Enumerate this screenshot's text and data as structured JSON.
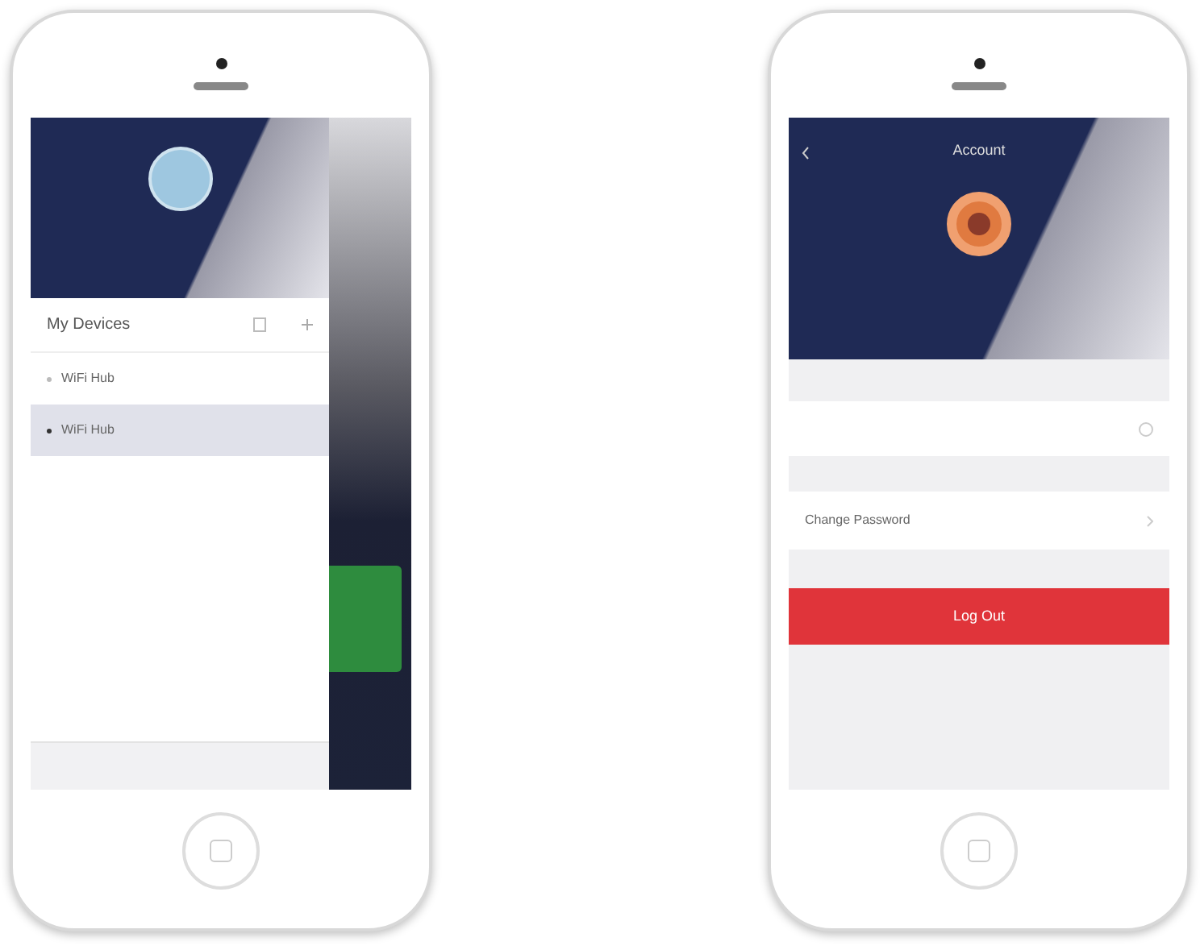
{
  "left_phone": {
    "drawer": {
      "title": "My Devices",
      "devices": [
        {
          "label": "WiFi Hub",
          "selected": false
        },
        {
          "label": "WiFi Hub",
          "selected": true
        }
      ]
    }
  },
  "right_phone": {
    "title": "Account",
    "rows": [
      {
        "label": "Change Password"
      }
    ],
    "logout_button": "Log Out"
  }
}
